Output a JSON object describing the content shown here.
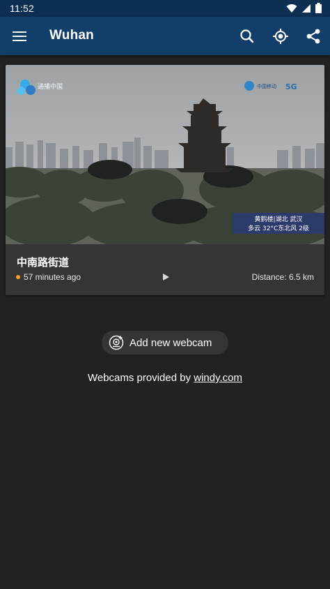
{
  "status": {
    "time": "11:52"
  },
  "app_bar": {
    "title": "Wuhan"
  },
  "webcam": {
    "name": "中南路街道",
    "updated": "57 minutes ago",
    "distance": "Distance: 6.5 km",
    "overlay_line1": "黄鹤楼|湖北 武汉",
    "overlay_line2": "多云 32°C东北风 2级",
    "brand_left": "通播中国",
    "brand_right": "中国移动",
    "brand_5g": "5G"
  },
  "actions": {
    "add_webcam": "Add new webcam"
  },
  "footer": {
    "prefix": "Webcams provided by ",
    "link": "windy.com"
  },
  "colors": {
    "status_bar": "#0c2f52",
    "app_bar": "#123f6a",
    "background": "#222222",
    "card": "#353535",
    "live_dot": "#f2a21b"
  }
}
